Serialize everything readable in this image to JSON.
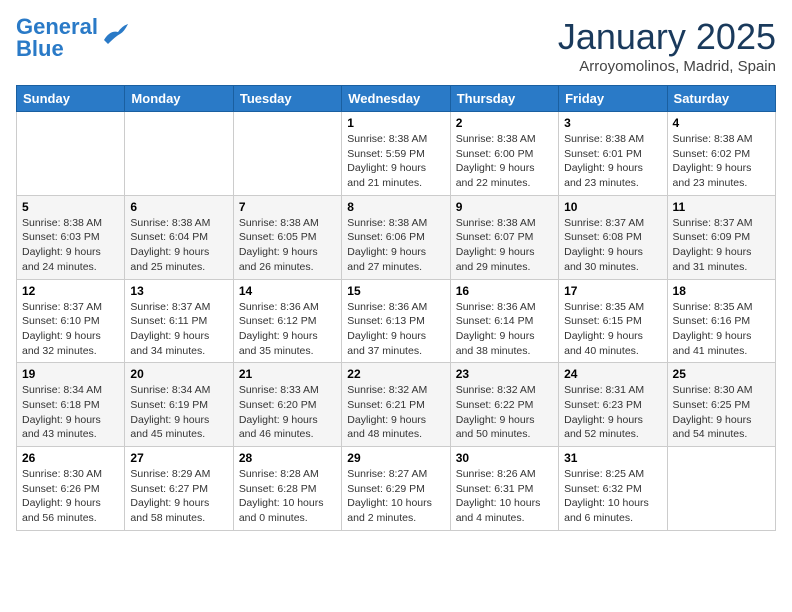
{
  "logo": {
    "line1": "General",
    "line2": "Blue"
  },
  "header": {
    "month_year": "January 2025",
    "location": "Arroyomolinos, Madrid, Spain"
  },
  "weekdays": [
    "Sunday",
    "Monday",
    "Tuesday",
    "Wednesday",
    "Thursday",
    "Friday",
    "Saturday"
  ],
  "weeks": [
    [
      {
        "day": "",
        "info": ""
      },
      {
        "day": "",
        "info": ""
      },
      {
        "day": "",
        "info": ""
      },
      {
        "day": "1",
        "info": "Sunrise: 8:38 AM\nSunset: 5:59 PM\nDaylight: 9 hours\nand 21 minutes."
      },
      {
        "day": "2",
        "info": "Sunrise: 8:38 AM\nSunset: 6:00 PM\nDaylight: 9 hours\nand 22 minutes."
      },
      {
        "day": "3",
        "info": "Sunrise: 8:38 AM\nSunset: 6:01 PM\nDaylight: 9 hours\nand 23 minutes."
      },
      {
        "day": "4",
        "info": "Sunrise: 8:38 AM\nSunset: 6:02 PM\nDaylight: 9 hours\nand 23 minutes."
      }
    ],
    [
      {
        "day": "5",
        "info": "Sunrise: 8:38 AM\nSunset: 6:03 PM\nDaylight: 9 hours\nand 24 minutes."
      },
      {
        "day": "6",
        "info": "Sunrise: 8:38 AM\nSunset: 6:04 PM\nDaylight: 9 hours\nand 25 minutes."
      },
      {
        "day": "7",
        "info": "Sunrise: 8:38 AM\nSunset: 6:05 PM\nDaylight: 9 hours\nand 26 minutes."
      },
      {
        "day": "8",
        "info": "Sunrise: 8:38 AM\nSunset: 6:06 PM\nDaylight: 9 hours\nand 27 minutes."
      },
      {
        "day": "9",
        "info": "Sunrise: 8:38 AM\nSunset: 6:07 PM\nDaylight: 9 hours\nand 29 minutes."
      },
      {
        "day": "10",
        "info": "Sunrise: 8:37 AM\nSunset: 6:08 PM\nDaylight: 9 hours\nand 30 minutes."
      },
      {
        "day": "11",
        "info": "Sunrise: 8:37 AM\nSunset: 6:09 PM\nDaylight: 9 hours\nand 31 minutes."
      }
    ],
    [
      {
        "day": "12",
        "info": "Sunrise: 8:37 AM\nSunset: 6:10 PM\nDaylight: 9 hours\nand 32 minutes."
      },
      {
        "day": "13",
        "info": "Sunrise: 8:37 AM\nSunset: 6:11 PM\nDaylight: 9 hours\nand 34 minutes."
      },
      {
        "day": "14",
        "info": "Sunrise: 8:36 AM\nSunset: 6:12 PM\nDaylight: 9 hours\nand 35 minutes."
      },
      {
        "day": "15",
        "info": "Sunrise: 8:36 AM\nSunset: 6:13 PM\nDaylight: 9 hours\nand 37 minutes."
      },
      {
        "day": "16",
        "info": "Sunrise: 8:36 AM\nSunset: 6:14 PM\nDaylight: 9 hours\nand 38 minutes."
      },
      {
        "day": "17",
        "info": "Sunrise: 8:35 AM\nSunset: 6:15 PM\nDaylight: 9 hours\nand 40 minutes."
      },
      {
        "day": "18",
        "info": "Sunrise: 8:35 AM\nSunset: 6:16 PM\nDaylight: 9 hours\nand 41 minutes."
      }
    ],
    [
      {
        "day": "19",
        "info": "Sunrise: 8:34 AM\nSunset: 6:18 PM\nDaylight: 9 hours\nand 43 minutes."
      },
      {
        "day": "20",
        "info": "Sunrise: 8:34 AM\nSunset: 6:19 PM\nDaylight: 9 hours\nand 45 minutes."
      },
      {
        "day": "21",
        "info": "Sunrise: 8:33 AM\nSunset: 6:20 PM\nDaylight: 9 hours\nand 46 minutes."
      },
      {
        "day": "22",
        "info": "Sunrise: 8:32 AM\nSunset: 6:21 PM\nDaylight: 9 hours\nand 48 minutes."
      },
      {
        "day": "23",
        "info": "Sunrise: 8:32 AM\nSunset: 6:22 PM\nDaylight: 9 hours\nand 50 minutes."
      },
      {
        "day": "24",
        "info": "Sunrise: 8:31 AM\nSunset: 6:23 PM\nDaylight: 9 hours\nand 52 minutes."
      },
      {
        "day": "25",
        "info": "Sunrise: 8:30 AM\nSunset: 6:25 PM\nDaylight: 9 hours\nand 54 minutes."
      }
    ],
    [
      {
        "day": "26",
        "info": "Sunrise: 8:30 AM\nSunset: 6:26 PM\nDaylight: 9 hours\nand 56 minutes."
      },
      {
        "day": "27",
        "info": "Sunrise: 8:29 AM\nSunset: 6:27 PM\nDaylight: 9 hours\nand 58 minutes."
      },
      {
        "day": "28",
        "info": "Sunrise: 8:28 AM\nSunset: 6:28 PM\nDaylight: 10 hours\nand 0 minutes."
      },
      {
        "day": "29",
        "info": "Sunrise: 8:27 AM\nSunset: 6:29 PM\nDaylight: 10 hours\nand 2 minutes."
      },
      {
        "day": "30",
        "info": "Sunrise: 8:26 AM\nSunset: 6:31 PM\nDaylight: 10 hours\nand 4 minutes."
      },
      {
        "day": "31",
        "info": "Sunrise: 8:25 AM\nSunset: 6:32 PM\nDaylight: 10 hours\nand 6 minutes."
      },
      {
        "day": "",
        "info": ""
      }
    ]
  ]
}
